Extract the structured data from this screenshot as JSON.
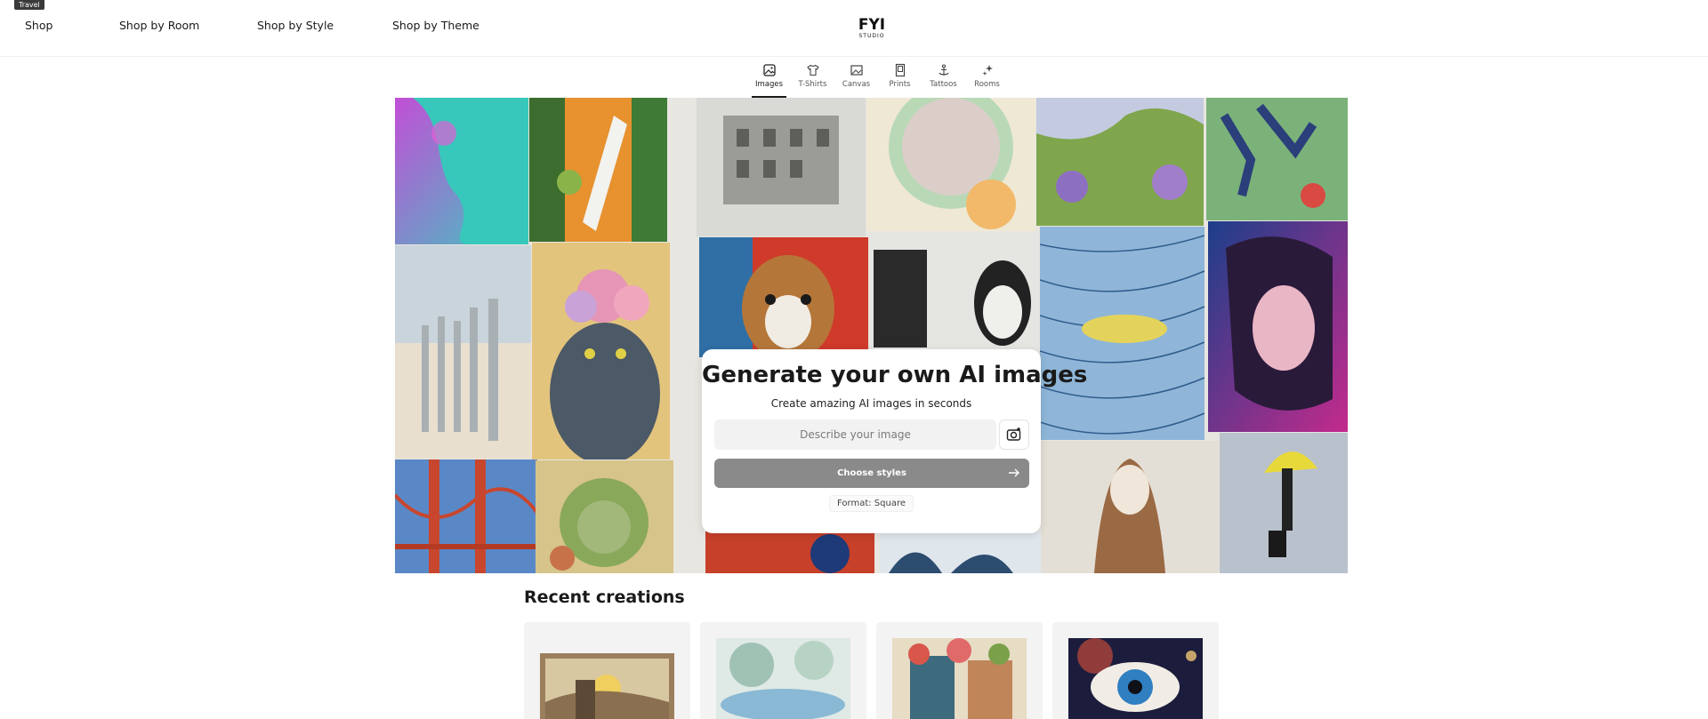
{
  "tooltip": "Travel",
  "nav": {
    "shop": "Shop",
    "room": "Shop by Room",
    "style": "Shop by Style",
    "theme": "Shop by Theme"
  },
  "logo": {
    "line1": "FYI",
    "line2": "STUDIO"
  },
  "tabs": [
    {
      "label": "Images",
      "icon": "image-icon",
      "active": true
    },
    {
      "label": "T-Shirts",
      "icon": "tshirt-icon",
      "active": false
    },
    {
      "label": "Canvas",
      "icon": "canvas-icon",
      "active": false
    },
    {
      "label": "Prints",
      "icon": "print-icon",
      "active": false
    },
    {
      "label": "Tattoos",
      "icon": "tattoo-icon",
      "active": false
    },
    {
      "label": "Rooms",
      "icon": "sparkle-icon",
      "active": false
    }
  ],
  "generator": {
    "title": "Generate your own AI images",
    "subtitle": "Create amazing AI images in seconds",
    "prompt_placeholder": "Describe your image",
    "choose_label": "Choose styles",
    "format": "Format: Square"
  },
  "recent": {
    "title": "Recent creations"
  },
  "colors": {
    "button": "#8a8a8a",
    "input_bg": "#f2f2f2",
    "text": "#1a1a1a"
  }
}
